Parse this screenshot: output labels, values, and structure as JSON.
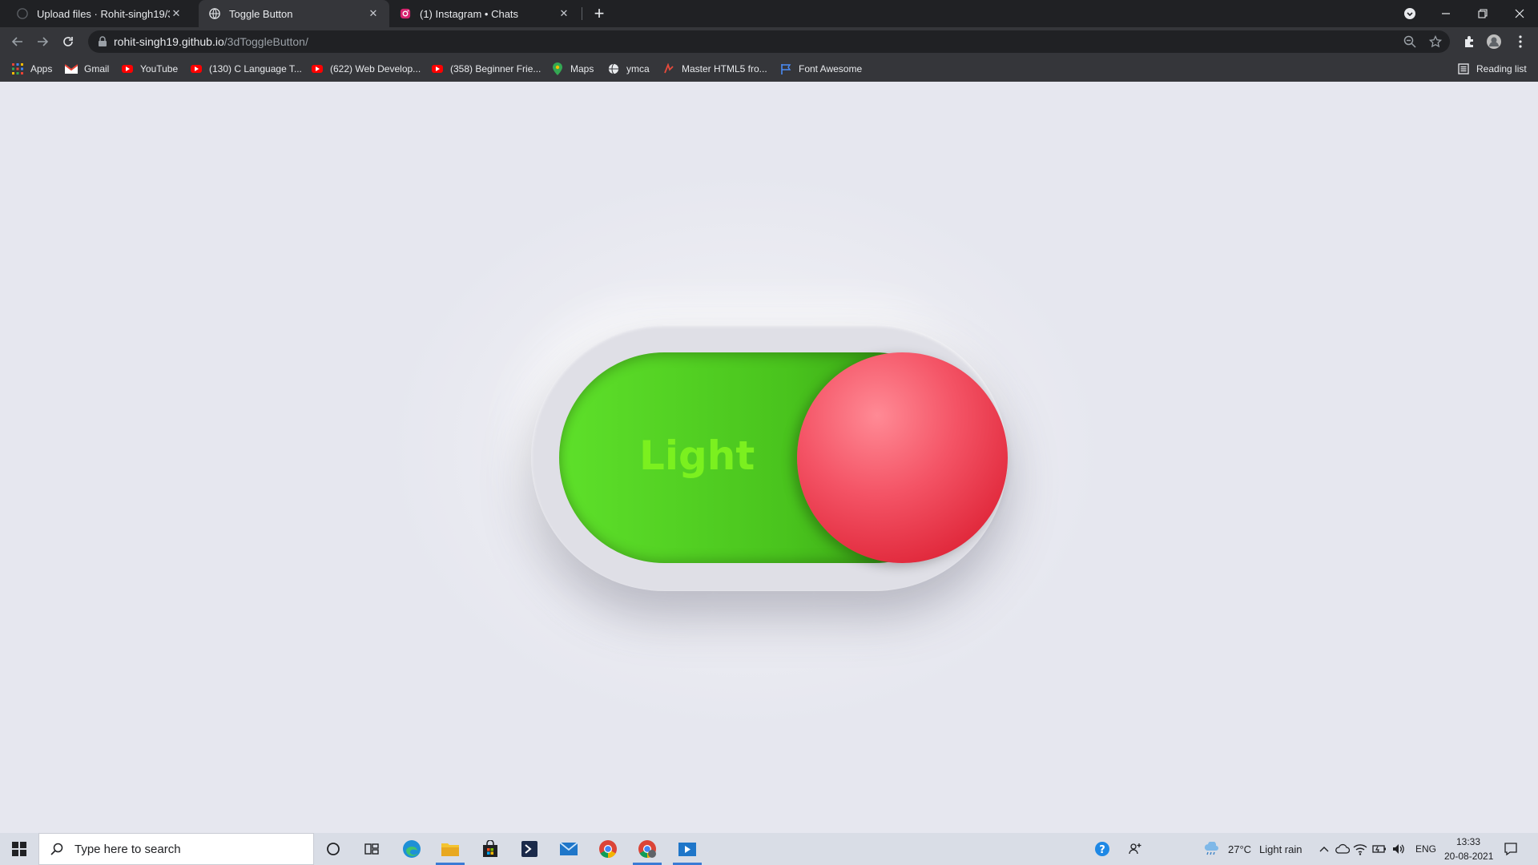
{
  "browser": {
    "tabs": [
      {
        "title": "Upload files · Rohit-singh19/3dTo",
        "active": false,
        "icon": "github-icon"
      },
      {
        "title": "Toggle Button",
        "active": true,
        "icon": "globe-icon"
      },
      {
        "title": "(1) Instagram • Chats",
        "active": false,
        "icon": "instagram-icon"
      }
    ],
    "address": {
      "host": "rohit-singh19.github.io",
      "path": "/3dToggleButton/"
    },
    "bookmarks": [
      {
        "label": "Apps",
        "icon": "apps-grid-icon"
      },
      {
        "label": "Gmail",
        "icon": "gmail-icon"
      },
      {
        "label": "YouTube",
        "icon": "youtube-icon"
      },
      {
        "label": "(130) C Language T...",
        "icon": "youtube-icon"
      },
      {
        "label": "(622) Web Develop...",
        "icon": "youtube-icon"
      },
      {
        "label": "(358) Beginner Frie...",
        "icon": "youtube-icon"
      },
      {
        "label": "Maps",
        "icon": "maps-icon"
      },
      {
        "label": "ymca",
        "icon": "globe-icon"
      },
      {
        "label": "Master HTML5 fro...",
        "icon": "bookmark-icon"
      },
      {
        "label": "Font Awesome",
        "icon": "flag-icon"
      }
    ],
    "reading_list": "Reading list"
  },
  "page": {
    "toggle": {
      "label": "Light",
      "state": "on"
    },
    "colors": {
      "track": "#49c31d",
      "knob": "#e8303f",
      "label": "#7bf01f",
      "background": "#e6e7ef"
    }
  },
  "taskbar": {
    "search_placeholder": "Type here to search",
    "weather": {
      "temp": "27°C",
      "condition": "Light rain"
    },
    "language": "ENG",
    "time": "13:33",
    "date": "20-08-2021"
  }
}
